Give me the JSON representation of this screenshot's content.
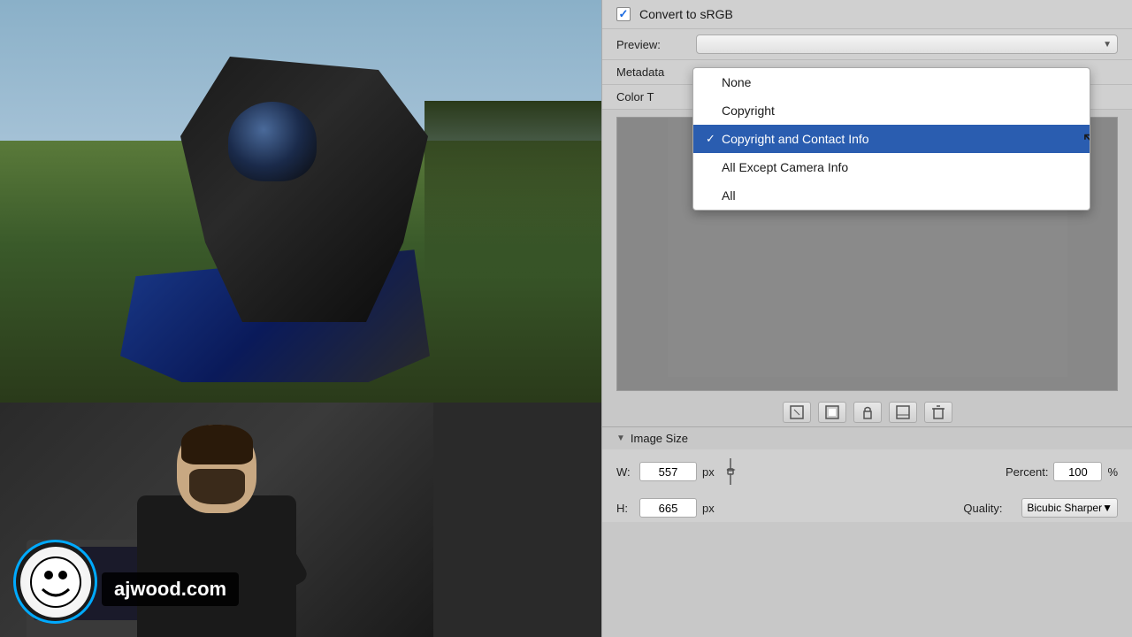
{
  "photo": {
    "alt": "Motorcycle rider scene"
  },
  "webcam": {
    "website": "ajwood.com"
  },
  "panel": {
    "convert_srgb_label": "Convert to sRGB",
    "preview_label": "Preview:",
    "metadata_label": "Metadata",
    "color_t_label": "Color T",
    "preview_value": "",
    "image_size_label": "Image Size",
    "w_label": "W:",
    "h_label": "H:",
    "w_value": "557",
    "h_value": "665",
    "px_unit": "px",
    "percent_label": "Percent:",
    "percent_value": "100",
    "percent_sign": "%",
    "quality_label": "Quality:",
    "quality_value": "Bicubic Sharper"
  },
  "dropdown": {
    "items": [
      {
        "id": "none",
        "label": "None",
        "checked": false
      },
      {
        "id": "copyright",
        "label": "Copyright",
        "checked": false
      },
      {
        "id": "copyright_contact",
        "label": "Copyright and Contact Info",
        "checked": true
      },
      {
        "id": "all_except_camera",
        "label": "All Except Camera Info",
        "checked": false
      },
      {
        "id": "all",
        "label": "All",
        "checked": false
      }
    ]
  },
  "toolbar_buttons": [
    {
      "id": "btn1",
      "icon": "⬜"
    },
    {
      "id": "btn2",
      "icon": "🔲"
    },
    {
      "id": "btn3",
      "icon": "🔒"
    },
    {
      "id": "btn4",
      "icon": "⬛"
    },
    {
      "id": "btn5",
      "icon": "🗑"
    }
  ],
  "icons": {
    "checkbox_check": "✓",
    "dropdown_arrow": "▼",
    "triangle": "▶",
    "link": "⬡",
    "checkmark_item": "✓"
  }
}
